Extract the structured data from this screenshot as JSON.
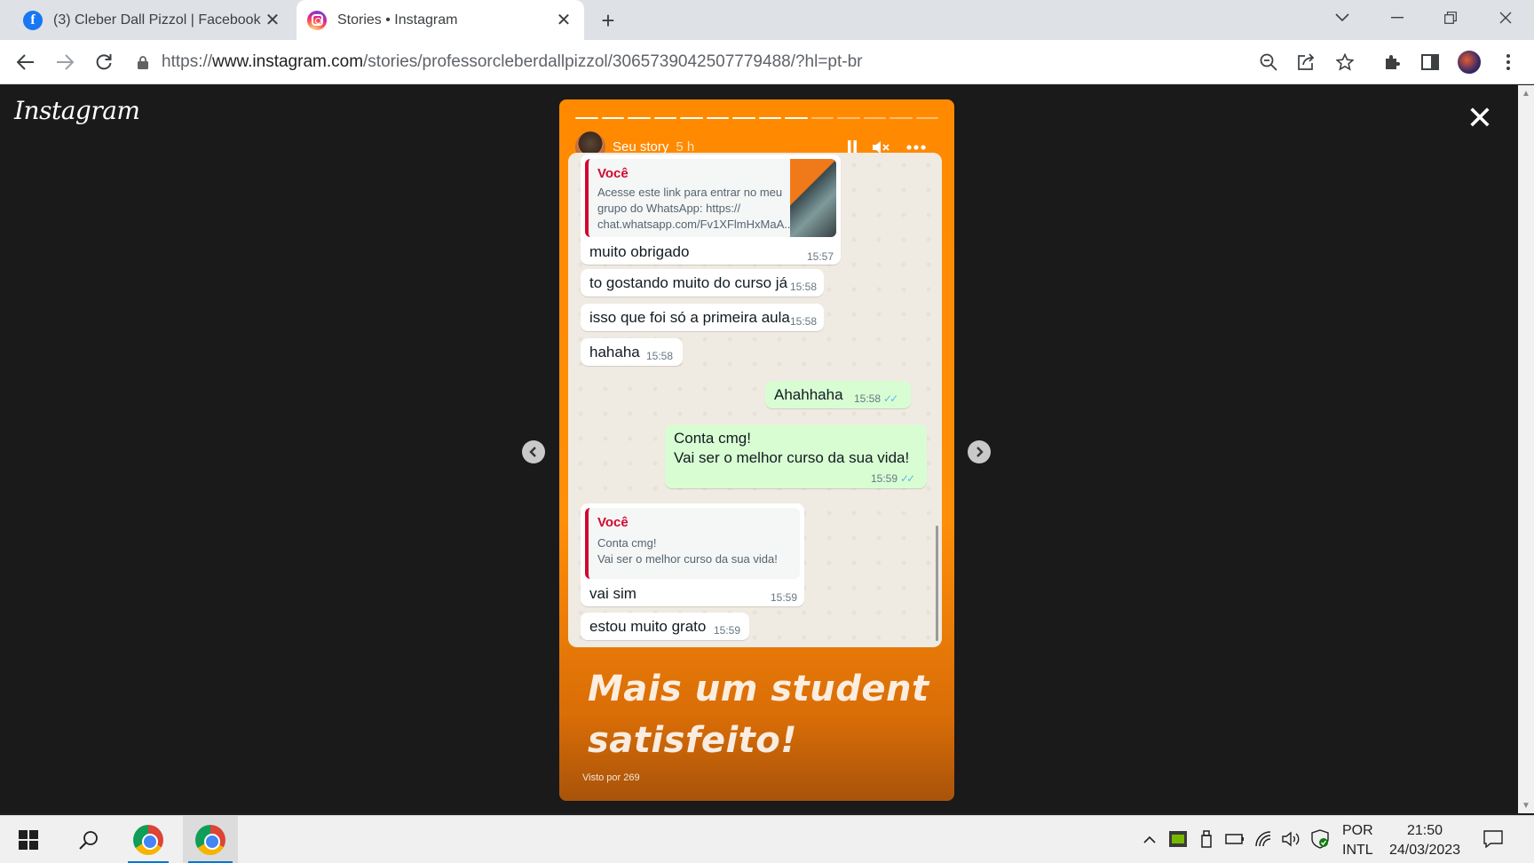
{
  "browser": {
    "tabs": [
      {
        "title": "(3) Cleber Dall Pizzol | Facebook",
        "icon": "facebook-icon",
        "close": "✕"
      },
      {
        "title": "Stories • Instagram",
        "icon": "instagram-icon",
        "close": "✕"
      }
    ],
    "new_tab": "+",
    "url_scheme": "https://",
    "url_host": "www.instagram.com",
    "url_path": "/stories/professorcleberdallpizzol/3065739042507779488/?hl=pt-br"
  },
  "page": {
    "logo": "Instagram",
    "close": "✕"
  },
  "story": {
    "user": "Seu story",
    "time": "5 h",
    "progress": {
      "total": 14,
      "done": 9
    },
    "caption_line1": "Mais um student",
    "caption_line2": "satisfeito!",
    "views": "Visto por 269",
    "chat": {
      "quote1": {
        "author": "Você",
        "lines": [
          "Acesse este link para entrar no meu",
          "grupo do WhatsApp: https://",
          "chat.whatsapp.com/Fv1XFlmHxMaA..."
        ]
      },
      "messages": [
        {
          "text": "muito obrigado",
          "time": "15:57"
        },
        {
          "text": "to gostando muito do curso já",
          "time": "15:58"
        },
        {
          "text": "isso que foi só a primeira aula",
          "time": "15:58"
        },
        {
          "text": "hahaha",
          "time": "15:58"
        },
        {
          "text": "Ahahhaha",
          "time": "15:58"
        },
        {
          "text": "Conta cmg!",
          "text2": "Vai ser o melhor curso da sua vida!",
          "time": "15:59"
        },
        {
          "text": "vai sim",
          "time": "15:59"
        },
        {
          "text": "estou muito grato",
          "time": "15:59"
        }
      ],
      "quote2": {
        "author": "Você",
        "lines": [
          "Conta cmg!",
          "Vai ser o melhor curso da sua vida!"
        ]
      },
      "read_ticks": "✓✓"
    }
  },
  "taskbar": {
    "lang_top": "POR",
    "lang_bottom": "INTL",
    "time": "21:50",
    "date": "24/03/2023"
  },
  "colors": {
    "story_orange": "#ff8a00",
    "quote_red": "#d10a30",
    "outgoing_bubble": "#d9fdd3",
    "read_ticks": "#53bdeb"
  }
}
